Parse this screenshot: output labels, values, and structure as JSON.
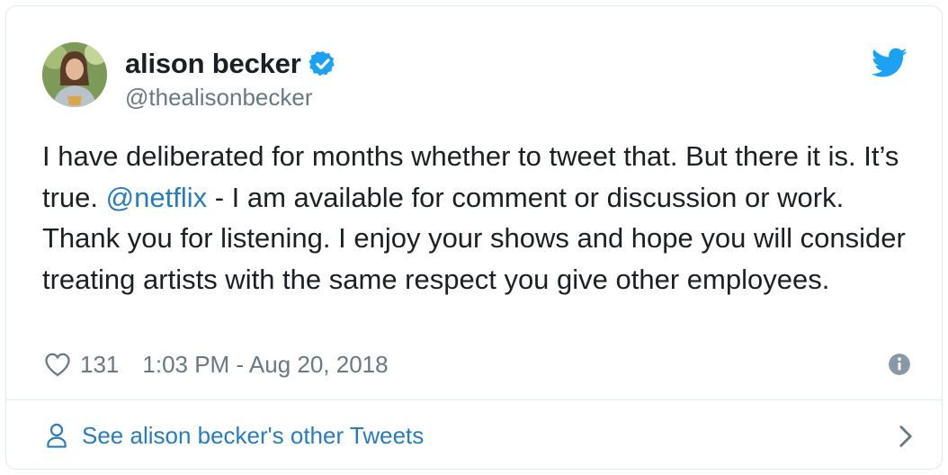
{
  "tweet": {
    "display_name": "alison becker",
    "handle": "@thealisonbecker",
    "text_part1": "I have deliberated for months whether to tweet that. But there it is. It’s true. ",
    "mention": "@netflix",
    "text_part2": " - I am available for comment or discussion or work. Thank you for listening. I enjoy your shows and hope you will consider treating artists with the same respect you give other employees.",
    "likes": "131",
    "timestamp": "1:03 PM - Aug 20, 2018"
  },
  "footer": {
    "link_label": "See alison becker's other Tweets"
  },
  "colors": {
    "brand": "#1da1f2",
    "link": "#2b7bb9",
    "text": "#1c2022",
    "muted": "#697882"
  },
  "icons": [
    "verified-badge-icon",
    "twitter-bird-icon",
    "heart-icon",
    "info-icon",
    "person-icon",
    "chevron-right-icon"
  ]
}
